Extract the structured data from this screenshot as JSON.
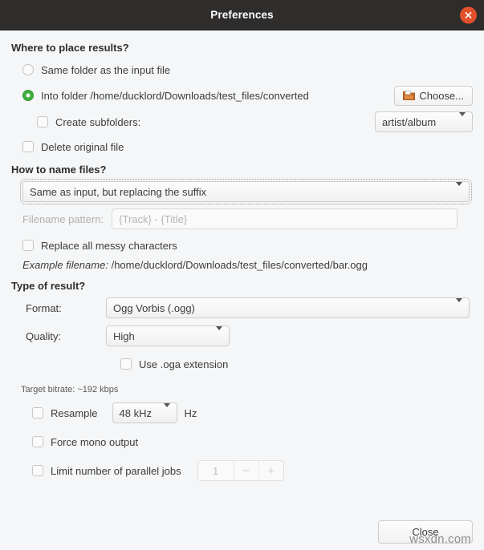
{
  "window": {
    "title": "Preferences",
    "close_icon": "close-icon"
  },
  "placement": {
    "heading": "Where to place results?",
    "option_same_folder": "Same folder as the input file",
    "option_into_folder": "Into folder /home/ducklord/Downloads/test_files/converted",
    "choose_button": "Choose...",
    "create_subfolders_label": "Create subfolders:",
    "subfolder_pattern": "artist/album",
    "delete_original_label": "Delete original file"
  },
  "naming": {
    "heading": "How to name files?",
    "scheme": "Same as input, but replacing the suffix",
    "filename_pattern_label": "Filename pattern:",
    "filename_pattern_placeholder": "{Track} - {Title}",
    "replace_messy_label": "Replace all messy characters",
    "example_prefix": "Example filename:",
    "example_path": "/home/ducklord/Downloads/test_files/converted/bar.ogg"
  },
  "result": {
    "heading": "Type of result?",
    "format_label": "Format:",
    "format_value": "Ogg Vorbis (.ogg)",
    "quality_label": "Quality:",
    "quality_value": "High",
    "use_oga_label": "Use .oga extension",
    "bitrate_text": "Target bitrate: ~192 kbps",
    "resample_label": "Resample",
    "resample_value": "48 kHz",
    "resample_unit": "Hz",
    "force_mono_label": "Force mono output",
    "limit_jobs_label": "Limit number of parallel jobs",
    "jobs_value": "1",
    "jobs_decrement": "−",
    "jobs_increment": "+"
  },
  "footer": {
    "close_label": "Close",
    "watermark": "wsxdn.com"
  },
  "colors": {
    "titlebar_bg": "#2f2d2c",
    "close_button": "#e2502b",
    "radio_selected": "#3fae3f",
    "window_bg": "#f5f6f7"
  }
}
